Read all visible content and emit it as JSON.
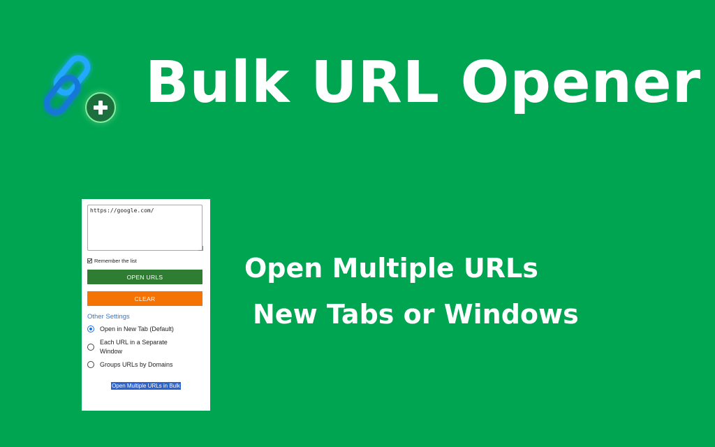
{
  "header": {
    "title": "Bulk URL Opener",
    "logo_icon": "chain-link-plus-icon"
  },
  "taglines": {
    "line1": "Open Multiple URLs",
    "line2": "New Tabs or Windows"
  },
  "popup": {
    "textarea_value": "https://google.com/",
    "remember_label": "Remember the list",
    "remember_checked": true,
    "open_button": "OPEN URLS",
    "clear_button": "CLEAR",
    "settings_heading": "Other Settings",
    "options": [
      {
        "label": "Open in New Tab (Default)",
        "checked": true
      },
      {
        "label": "Each URL in a Separate Window",
        "checked": false
      },
      {
        "label": "Groups URLs by Domains",
        "checked": false
      }
    ],
    "footer_text": "Open Multiple URLs in Bulk"
  },
  "colors": {
    "background": "#00a551",
    "open_button": "#2f7d32",
    "clear_button": "#f57304",
    "link_blue": "#3a74c4",
    "logo_blue": "#1e8cf0"
  }
}
